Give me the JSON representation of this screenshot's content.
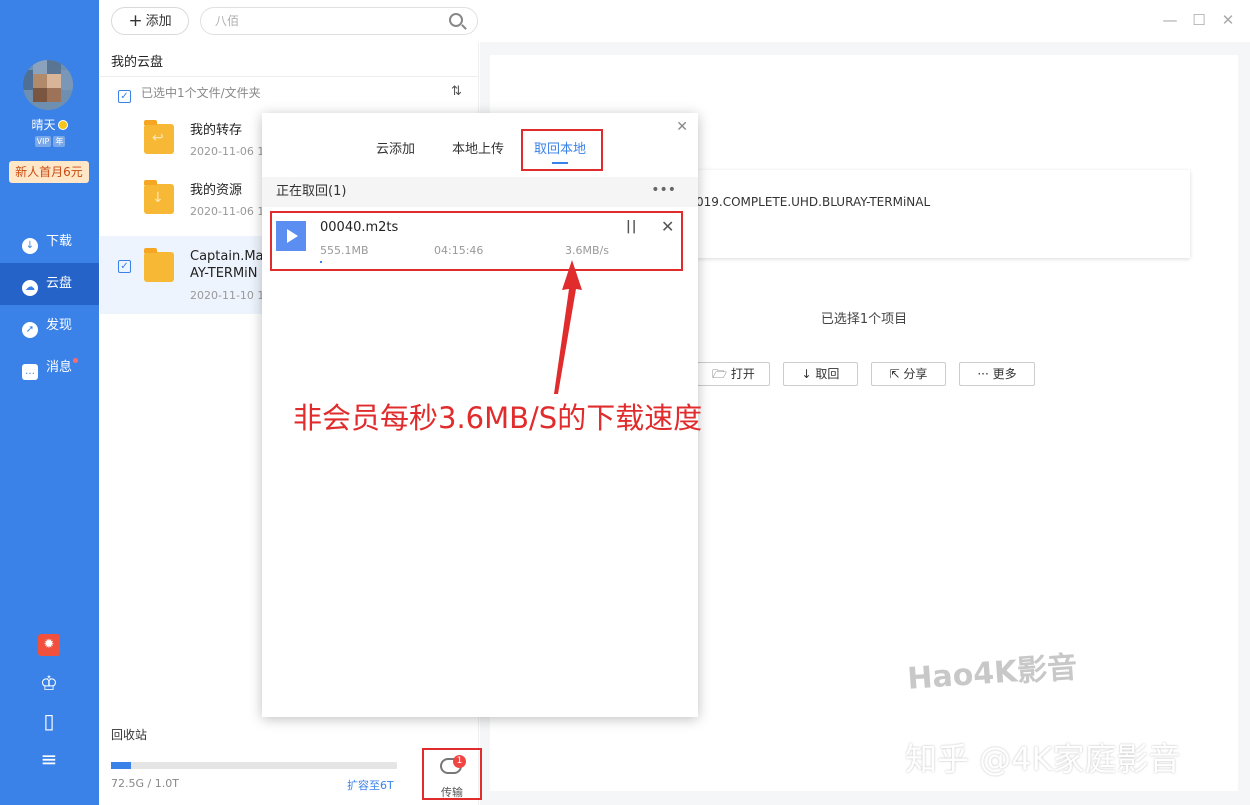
{
  "topbar": {
    "add_label": "添加",
    "search_placeholder": "八佰"
  },
  "sidebar": {
    "username": "晴天",
    "vip_badges": [
      "VIP",
      "年"
    ],
    "promo": "新人首月6元",
    "nav": [
      {
        "label": "下载",
        "icon": "download-icon"
      },
      {
        "label": "云盘",
        "icon": "cloud-icon",
        "active": true
      },
      {
        "label": "发现",
        "icon": "compass-icon"
      },
      {
        "label": "消息",
        "icon": "message-icon",
        "badge": true
      }
    ]
  },
  "files": {
    "header": "我的云盘",
    "selection_info": "已选中1个文件/文件夹",
    "items": [
      {
        "name": "我的转存",
        "date": "2020-11-06 15"
      },
      {
        "name": "我的资源",
        "date": "2020-11-06 15"
      },
      {
        "name_line1": "Captain.Mar",
        "name_line2": "AY-TERMiN",
        "date": "2020-11-10 17"
      }
    ],
    "recycle": "回收站",
    "quota_text": "72.5G / 1.0T",
    "quota_fraction": 0.07,
    "expand": "扩容至6T",
    "transfer_label": "传输",
    "transfer_badge": "1"
  },
  "detail": {
    "name": "019.COMPLETE.UHD.BLURAY-TERMiNAL",
    "selected_count": "已选择1个项目",
    "actions": [
      "打开",
      "取回",
      "分享",
      "更多"
    ]
  },
  "popup": {
    "tabs": [
      "云添加",
      "本地上传",
      "取回本地"
    ],
    "active_tab": 2,
    "section_header": "正在取回(1)",
    "item": {
      "name": "00040.m2ts",
      "size": "555.1MB",
      "time": "04:15:46",
      "speed": "3.6MB/s"
    }
  },
  "annotation": "非会员每秒3.6MB/S的下载速度",
  "watermarks": [
    "Hao4K影音",
    "知乎 @4K家庭影音"
  ],
  "colors": {
    "accent": "#3b82e8",
    "highlight": "#e02c2c"
  }
}
